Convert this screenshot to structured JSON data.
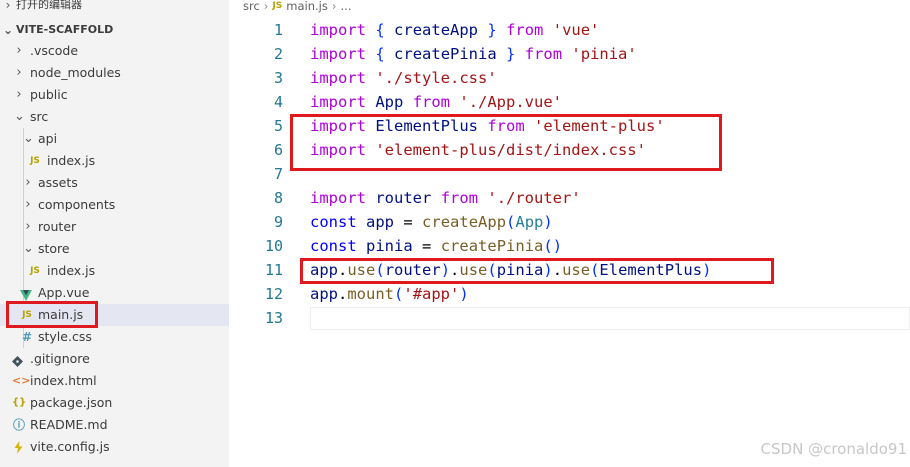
{
  "sidebar": {
    "open_editors_label": "打开的编辑器",
    "project_label": "VITE-SCAFFOLD",
    "items": [
      {
        "label": ".vscode",
        "kind": "folder",
        "expanded": false,
        "icon": "chevron-right-icon"
      },
      {
        "label": "node_modules",
        "kind": "folder",
        "expanded": false,
        "icon": "chevron-right-icon"
      },
      {
        "label": "public",
        "kind": "folder",
        "expanded": false,
        "icon": "chevron-right-icon"
      },
      {
        "label": "src",
        "kind": "folder",
        "expanded": true,
        "icon": "chevron-down-icon"
      },
      {
        "label": "api",
        "kind": "folder",
        "expanded": true,
        "icon": "chevron-down-icon"
      },
      {
        "label": "index.js",
        "kind": "file",
        "icon": "javascript-file-icon",
        "icon_text": "JS"
      },
      {
        "label": "assets",
        "kind": "folder",
        "expanded": false,
        "icon": "chevron-right-icon"
      },
      {
        "label": "components",
        "kind": "folder",
        "expanded": false,
        "icon": "chevron-right-icon"
      },
      {
        "label": "router",
        "kind": "folder",
        "expanded": false,
        "icon": "chevron-right-icon"
      },
      {
        "label": "store",
        "kind": "folder",
        "expanded": true,
        "icon": "chevron-down-icon"
      },
      {
        "label": "index.js",
        "kind": "file",
        "icon": "javascript-file-icon",
        "icon_text": "JS"
      },
      {
        "label": "App.vue",
        "kind": "file",
        "icon": "vue-file-icon"
      },
      {
        "label": "main.js",
        "kind": "file",
        "icon": "javascript-file-icon",
        "icon_text": "JS",
        "selected": true
      },
      {
        "label": "style.css",
        "kind": "file",
        "icon": "css-file-icon",
        "icon_text": "#"
      },
      {
        "label": ".gitignore",
        "kind": "file",
        "icon": "git-file-icon"
      },
      {
        "label": "index.html",
        "kind": "file",
        "icon": "html-file-icon",
        "icon_text": "<>"
      },
      {
        "label": "package.json",
        "kind": "file",
        "icon": "json-file-icon",
        "icon_text": "{}"
      },
      {
        "label": "README.md",
        "kind": "file",
        "icon": "info-file-icon",
        "icon_text": "ⓘ"
      },
      {
        "label": "vite.config.js",
        "kind": "file",
        "icon": "vite-file-icon"
      }
    ]
  },
  "editor": {
    "breadcrumb": {
      "folder": "src",
      "file_icon_text": "JS",
      "file": "main.js",
      "more": "..."
    },
    "lines": [
      {
        "number": "1",
        "text": "import { createApp } from 'vue'"
      },
      {
        "number": "2",
        "text": "import { createPinia } from 'pinia'"
      },
      {
        "number": "3",
        "text": "import './style.css'"
      },
      {
        "number": "4",
        "text": "import App from './App.vue'"
      },
      {
        "number": "5",
        "text": "import ElementPlus from 'element-plus'"
      },
      {
        "number": "6",
        "text": "import 'element-plus/dist/index.css'"
      },
      {
        "number": "7",
        "text": ""
      },
      {
        "number": "8",
        "text": "import router from './router'"
      },
      {
        "number": "9",
        "text": "const app = createApp(App)"
      },
      {
        "number": "10",
        "text": "const pinia = createPinia()"
      },
      {
        "number": "11",
        "text": "app.use(router).use(pinia).use(ElementPlus)"
      },
      {
        "number": "12",
        "text": "app.mount('#app')"
      },
      {
        "number": "13",
        "text": ""
      }
    ]
  },
  "annotation_color": "#e0191e",
  "watermark": "CSDN @cronaldo91"
}
